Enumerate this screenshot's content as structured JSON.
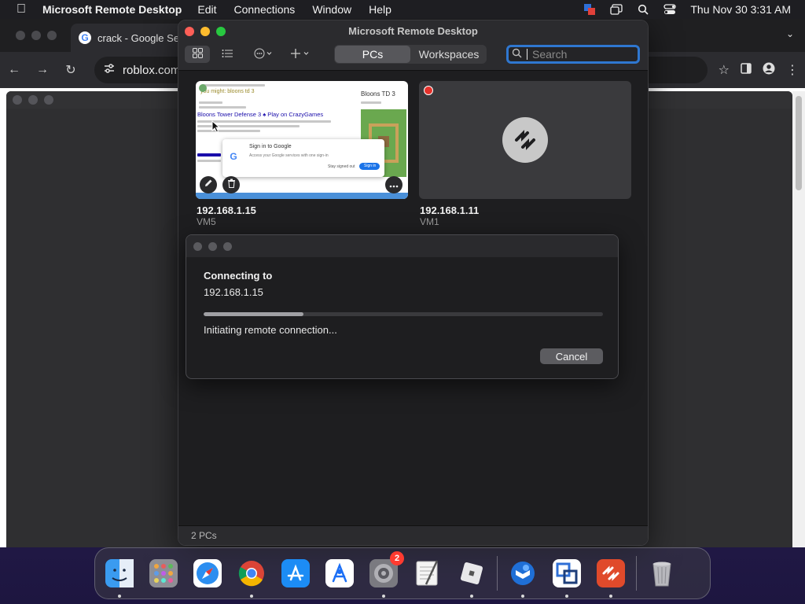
{
  "menubar": {
    "app_name": "Microsoft Remote Desktop",
    "menus": [
      "Edit",
      "Connections",
      "Window",
      "Help"
    ],
    "clock": "Thu Nov 30  3:31 AM"
  },
  "chrome": {
    "tab_title": "crack - Google Se",
    "url": "roblox.com"
  },
  "mrd": {
    "title": "Microsoft Remote Desktop",
    "segments": [
      "PCs",
      "Workspaces"
    ],
    "active_segment": "PCs",
    "search_placeholder": "Search",
    "pcs": [
      {
        "name": "192.168.1.15",
        "sub": "VM5"
      },
      {
        "name": "192.168.1.11",
        "sub": "VM1"
      }
    ],
    "footer": "2 PCs",
    "thumbnail": {
      "link_title": "Bloons Tower Defense 3 ♠ Play on CrazyGames",
      "side_title": "Bloons TD 3",
      "popup_title": "Sign in to Google",
      "popup_text": "Access your Google services with one sign-in",
      "popup_signin": "Sign in",
      "popup_stay": "Stay signed out"
    }
  },
  "dialog": {
    "heading": "Connecting to",
    "host": "192.168.1.15",
    "status": "Initiating remote connection...",
    "cancel": "Cancel",
    "progress": 0.25
  },
  "dock": {
    "apps": [
      {
        "name": "Finder",
        "color": "#3a9bf0",
        "running": true
      },
      {
        "name": "Launchpad",
        "color": "#8e8e95",
        "running": false
      },
      {
        "name": "Safari",
        "color": "#ffffff",
        "running": false
      },
      {
        "name": "Google Chrome",
        "color": "#ffffff",
        "running": true
      },
      {
        "name": "App Store",
        "color": "#1c8cf5",
        "running": false
      },
      {
        "name": "Xcode Instruments",
        "color": "#ffffff",
        "running": false
      },
      {
        "name": "System Settings",
        "color": "#7a7a80",
        "running": true,
        "badge": "2"
      },
      {
        "name": "TextEdit",
        "color": "#f4f4f4",
        "running": false
      },
      {
        "name": "Roblox",
        "color": "#cfcfd2",
        "running": true
      },
      {
        "name": "Thunderbird",
        "color": "#ffffff",
        "running": true
      },
      {
        "name": "VMware Horizon",
        "color": "#ffffff",
        "running": true
      },
      {
        "name": "Microsoft Remote Desktop",
        "color": "#e04a2b",
        "running": true
      },
      {
        "name": "Trash",
        "color": "#9a9aa0",
        "running": false
      }
    ]
  }
}
